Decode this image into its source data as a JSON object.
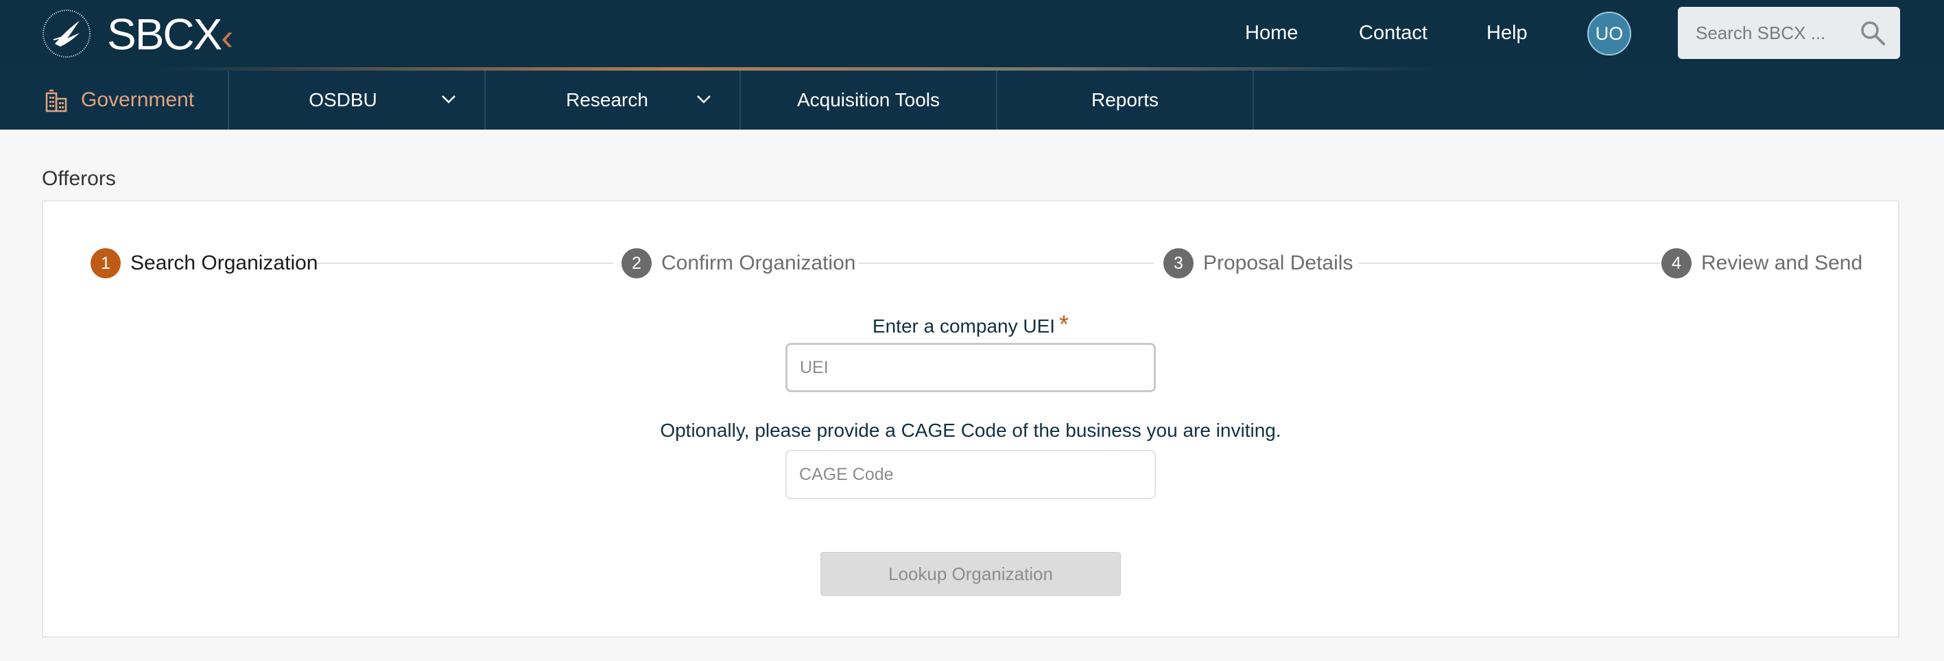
{
  "header": {
    "logo_text": "SBCX",
    "nav": [
      {
        "label": "Home"
      },
      {
        "label": "Contact"
      },
      {
        "label": "Help"
      }
    ],
    "avatar_initials": "UO",
    "search_placeholder": "Search SBCX ...",
    "search_icon": "search-icon",
    "logo_icon": "hhs-eagle-seal-icon"
  },
  "subnav": {
    "government_label": "Government",
    "items": [
      {
        "label": "OSDBU",
        "has_dropdown": true
      },
      {
        "label": "Research",
        "has_dropdown": true
      },
      {
        "label": "Acquisition Tools",
        "has_dropdown": false
      },
      {
        "label": "Reports",
        "has_dropdown": false
      }
    ]
  },
  "page": {
    "section_title": "Offerors"
  },
  "stepper": {
    "steps": [
      {
        "num": "1",
        "label": "Search Organization",
        "active": true
      },
      {
        "num": "2",
        "label": "Confirm Organization",
        "active": false
      },
      {
        "num": "3",
        "label": "Proposal Details",
        "active": false
      },
      {
        "num": "4",
        "label": "Review and Send",
        "active": false
      }
    ]
  },
  "form": {
    "uei_label": "Enter a company UEI",
    "required_mark": "*",
    "uei_placeholder": "UEI",
    "cage_label": "Optionally, please provide a CAGE Code of the business you are inviting.",
    "cage_placeholder": "CAGE Code",
    "lookup_button": "Lookup Organization"
  },
  "colors": {
    "header_bg": "#0d3045",
    "accent_orange": "#c05b16",
    "step_inactive": "#6b6b6b",
    "avatar_bg": "#3b82a5"
  }
}
